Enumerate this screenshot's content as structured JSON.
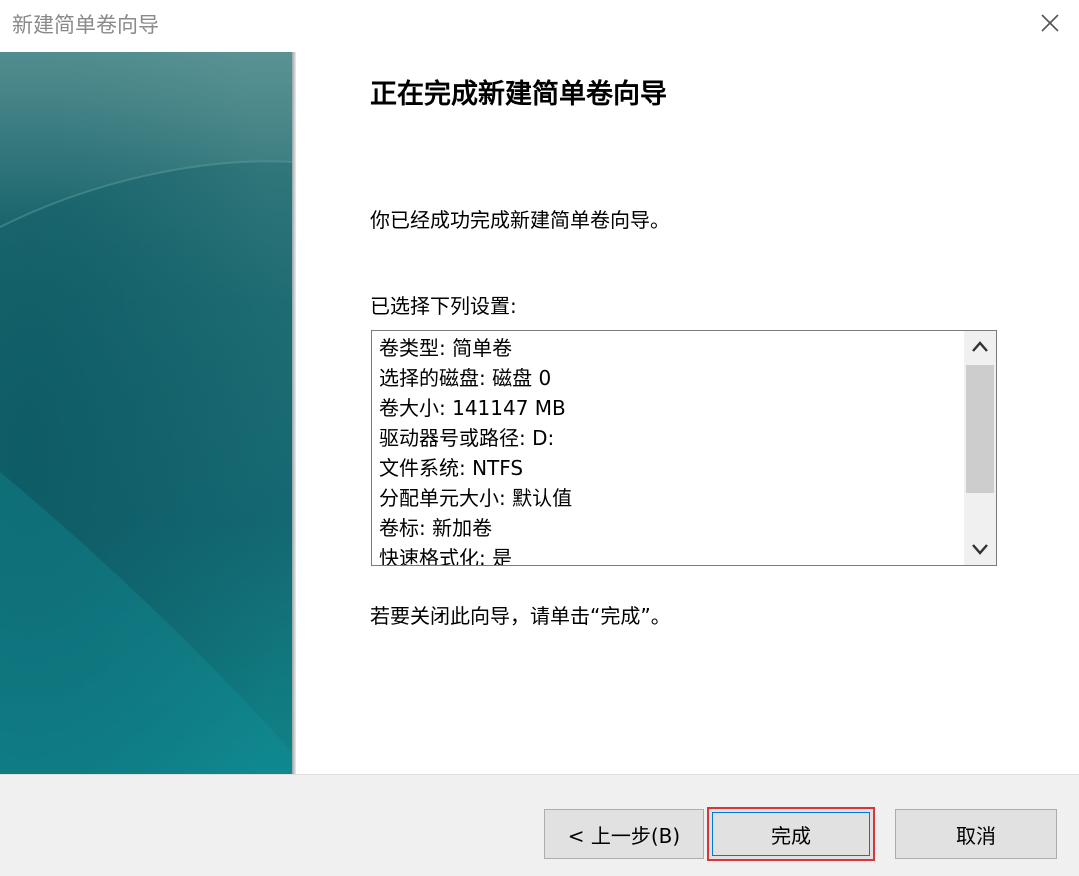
{
  "window": {
    "title": "新建简单卷向导"
  },
  "main": {
    "heading": "正在完成新建简单卷向导",
    "success_text": "你已经成功完成新建简单卷向导。",
    "settings_label": "已选择下列设置:",
    "settings": [
      "卷类型: 简单卷",
      "选择的磁盘: 磁盘 0",
      "卷大小: 141147 MB",
      "驱动器号或路径: D:",
      "文件系统: NTFS",
      "分配单元大小: 默认值",
      "卷标: 新加卷",
      "快速格式化: 是"
    ],
    "close_hint": "若要关闭此向导，请单击“完成”。"
  },
  "buttons": {
    "back": "< 上一步(B)",
    "finish": "完成",
    "cancel": "取消"
  },
  "colors": {
    "side_panel_teal": "#146872",
    "highlight_red": "#d9363a"
  },
  "icons": {
    "close": "close-icon",
    "scroll_up": "chevron-up-icon",
    "scroll_down": "chevron-down-icon"
  }
}
